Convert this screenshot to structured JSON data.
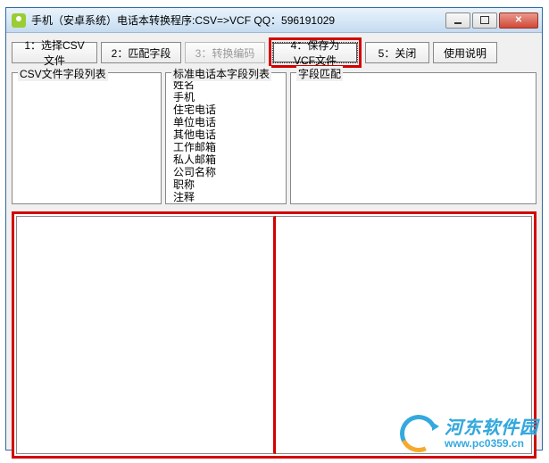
{
  "titlebar": {
    "text": "手机（安卓系统）电话本转换程序:CSV=>VCF      QQ：596191029"
  },
  "toolbar": {
    "b1": "1：选择CSV文件",
    "b2": "2：匹配字段",
    "b3": "3：转换编码",
    "b4": "4：保存为VCF文件",
    "b5": "5：关闭",
    "b6": "使用说明"
  },
  "panels": {
    "p1_label": "CSV文件字段列表",
    "p2_label": "标准电话本字段列表",
    "p3_label": "字段匹配",
    "std_fields": [
      "姓名",
      "手机",
      "住宅电话",
      "单位电话",
      "其他电话",
      "工作邮箱",
      "私人邮箱",
      "公司名称",
      "职称",
      "注释"
    ]
  },
  "watermark": {
    "title": "河东软件园",
    "url": "www.pc0359.cn"
  }
}
